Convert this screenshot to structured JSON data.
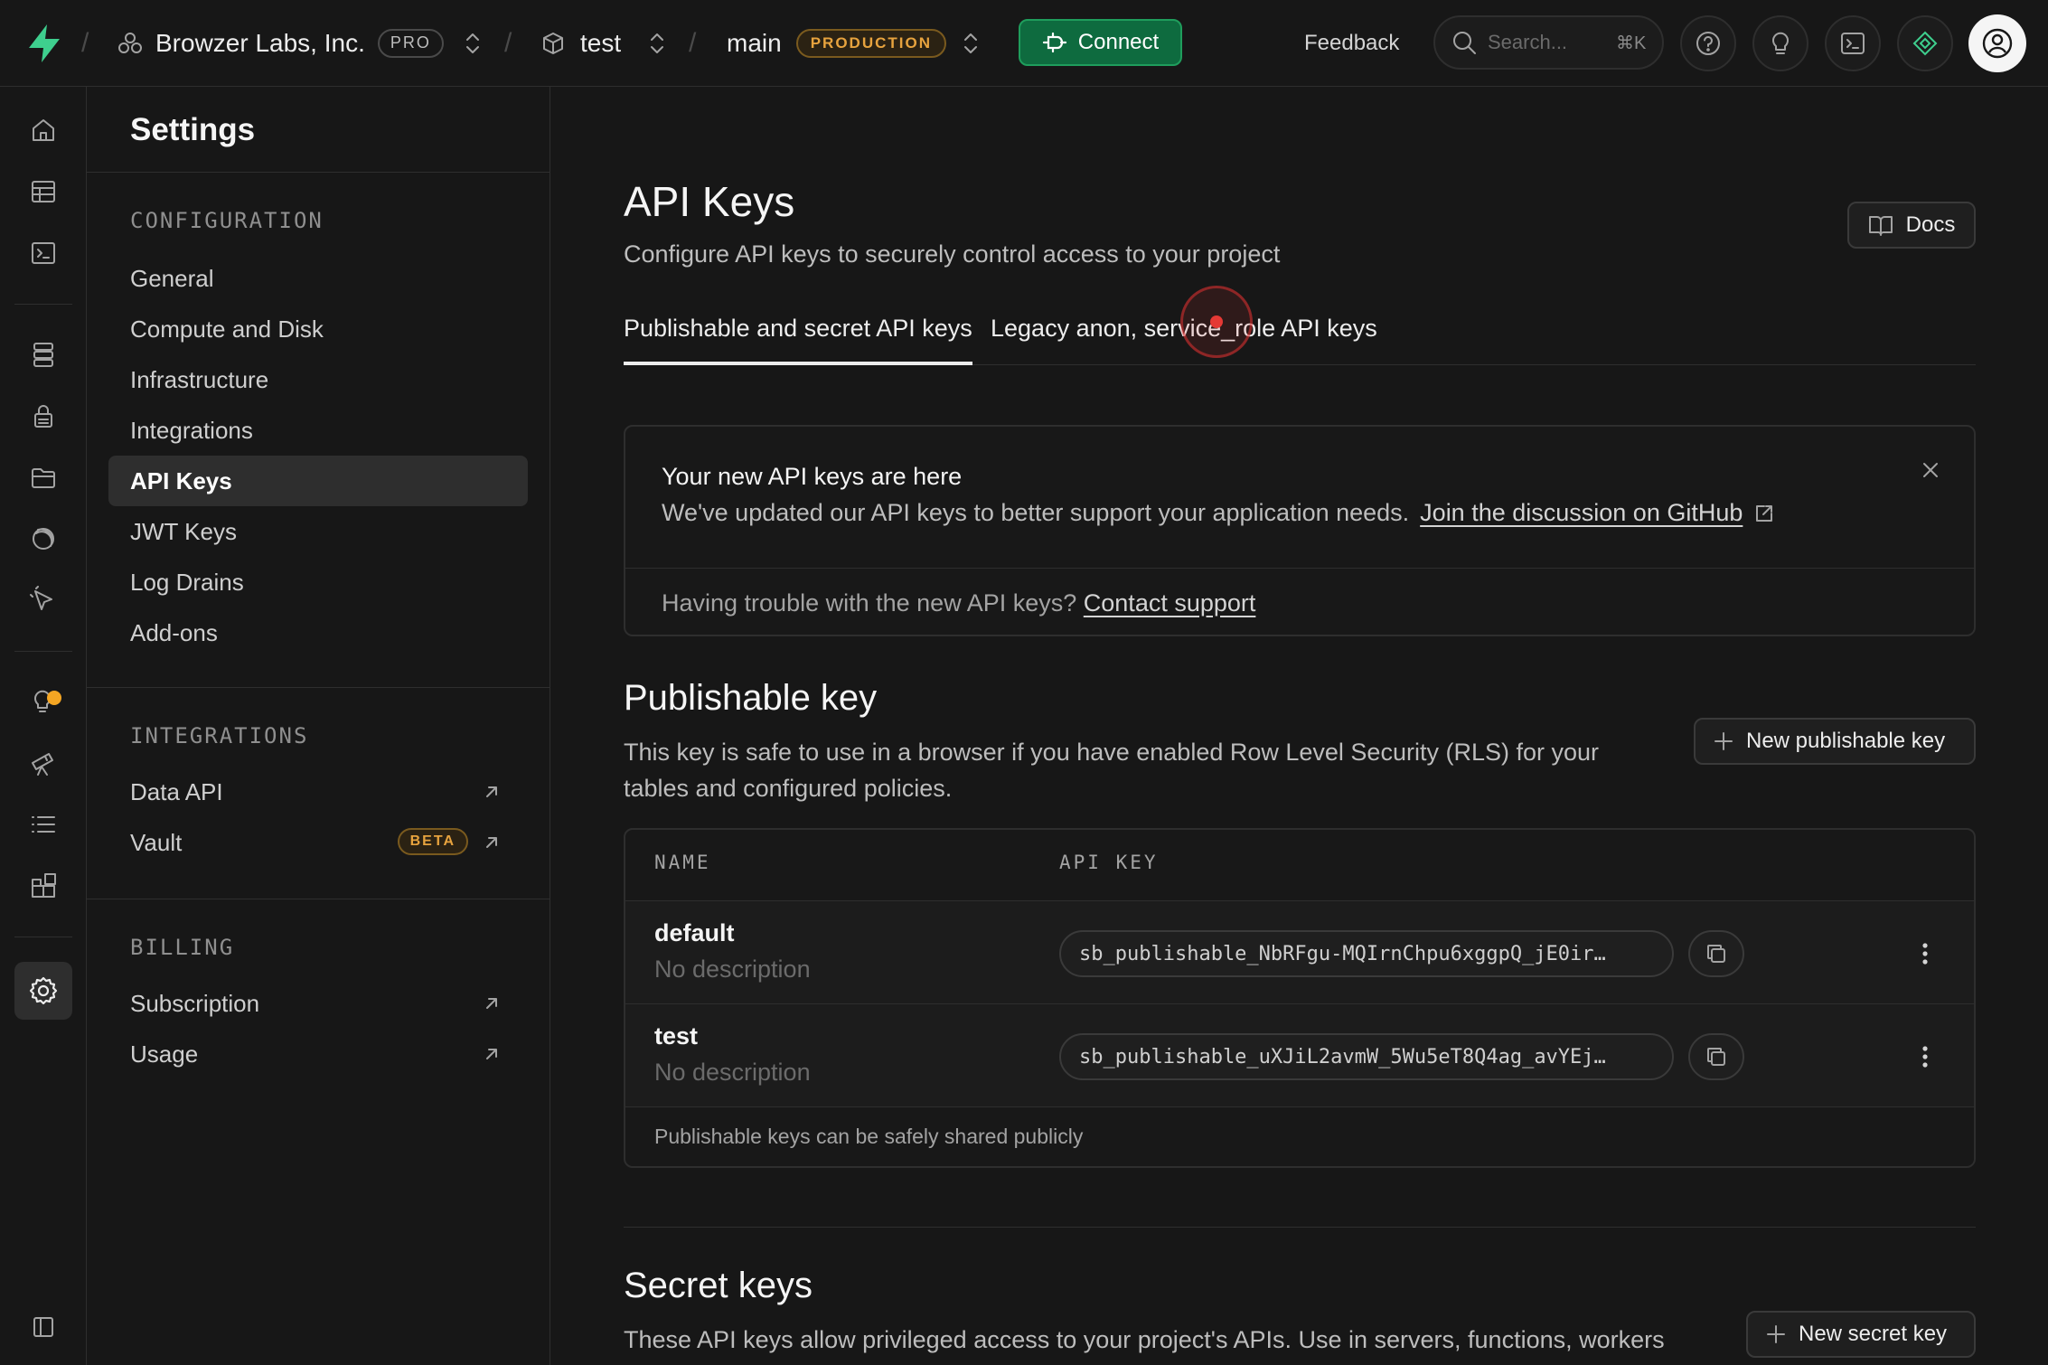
{
  "topbar": {
    "org_name": "Browzer Labs, Inc.",
    "org_plan": "PRO",
    "project_name": "test",
    "branch_name": "main",
    "branch_badge": "PRODUCTION",
    "connect_label": "Connect",
    "feedback_label": "Feedback",
    "search_placeholder": "Search...",
    "search_shortcut": "⌘K"
  },
  "rail": {
    "items": [
      "home-icon",
      "table-editor-icon",
      "sql-editor-icon",
      "database-icon",
      "auth-icon",
      "storage-icon",
      "edge-functions-icon",
      "realtime-icon",
      "advisors-icon",
      "reports-icon",
      "logs-icon",
      "integrations-icon",
      "settings-icon"
    ],
    "active": "settings-icon",
    "notification_color": "#f5a623"
  },
  "sidebar": {
    "title": "Settings",
    "configuration": {
      "label": "CONFIGURATION",
      "items": [
        "General",
        "Compute and Disk",
        "Infrastructure",
        "Integrations",
        "API Keys",
        "JWT Keys",
        "Log Drains",
        "Add-ons"
      ],
      "active": "API Keys"
    },
    "integrations": {
      "label": "INTEGRATIONS",
      "items": [
        "Data API",
        "Vault"
      ],
      "vault_badge": "BETA"
    },
    "billing": {
      "label": "BILLING",
      "items": [
        "Subscription",
        "Usage"
      ]
    }
  },
  "main": {
    "title": "API Keys",
    "subtitle": "Configure API keys to securely control access to your project",
    "docs_label": "Docs",
    "tabs": [
      "Publishable and secret API keys",
      "Legacy anon, service_role API keys"
    ],
    "active_tab": "Publishable and secret API keys",
    "notice": {
      "title": "Your new API keys are here",
      "body": "We've updated our API keys to better support your application needs.",
      "link": "Join the discussion on GitHub",
      "foot_text": "Having trouble with the new API keys?",
      "foot_link": "Contact support"
    },
    "publishable": {
      "title": "Publishable key",
      "desc_line1": "This key is safe to use in a browser if you have enabled Row Level Security (RLS) for your",
      "desc_line2": "tables and configured policies.",
      "new_label": "New publishable key",
      "columns": [
        "NAME",
        "API KEY"
      ],
      "rows": [
        {
          "name": "default",
          "description": "No description",
          "key": "sb_publishable_NbRFgu-MQIrnChpu6xggpQ_jE0ir…"
        },
        {
          "name": "test",
          "description": "No description",
          "key": "sb_publishable_uXJiL2avmW_5Wu5eT8Q4ag_avYEj…"
        }
      ],
      "footer": "Publishable keys can be safely shared publicly"
    },
    "secret": {
      "title": "Secret keys",
      "desc": "These API keys allow privileged access to your project's APIs. Use in servers, functions, workers",
      "new_label": "New secret key"
    }
  },
  "colors": {
    "accent_green": "#1f9d5c",
    "warning_amber": "#e7a33e",
    "background": "#171717"
  }
}
